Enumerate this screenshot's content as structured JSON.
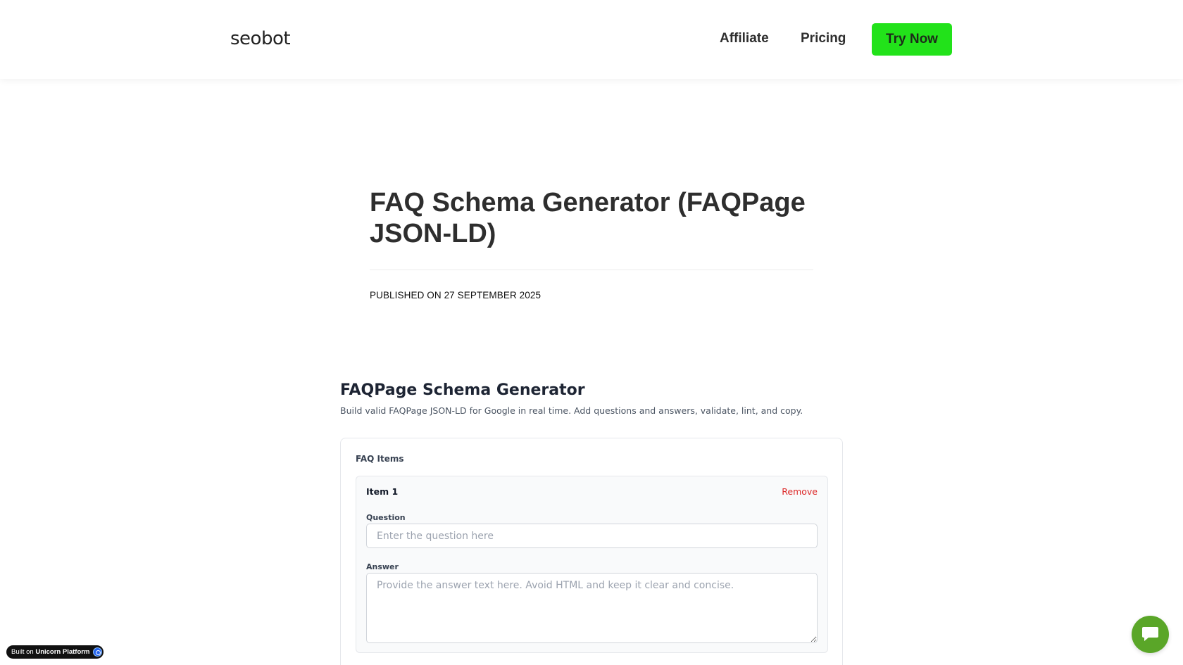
{
  "header": {
    "logo": "seobot",
    "nav": {
      "affiliate": "Affiliate",
      "pricing": "Pricing"
    },
    "cta": "Try Now",
    "cta_color": "#22e21a"
  },
  "article": {
    "title": "FAQ Schema Generator (FAQPage JSON-LD)",
    "published": "PUBLISHED ON 27 SEPTEMBER 2025"
  },
  "generator": {
    "title": "FAQPage Schema Generator",
    "subtitle": "Build valid FAQPage JSON-LD for Google in real time. Add questions and answers, validate, lint, and copy.",
    "section_heading": "FAQ Items",
    "items": [
      {
        "title": "Item 1",
        "remove_label": "Remove",
        "question_label": "Question",
        "question_placeholder": "Enter the question here",
        "question_value": "",
        "answer_label": "Answer",
        "answer_placeholder": "Provide the answer text here. Avoid HTML and keep it clear and concise.",
        "answer_value": ""
      }
    ]
  },
  "badge": {
    "prefix": "Built on",
    "brand": "Unicorn Platform",
    "icon": "unicorn-platform-icon"
  },
  "chat": {
    "icon": "chat-bubble-icon",
    "color": "#5aa628"
  }
}
